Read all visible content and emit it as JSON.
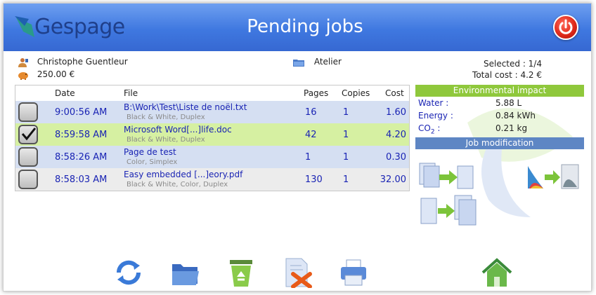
{
  "header": {
    "logo_text": "Gespage",
    "title": "Pending jobs",
    "power_icon": "power-icon"
  },
  "user": {
    "name": "Christophe Guentleur",
    "balance": "250.00 €",
    "printer": "Atelier"
  },
  "summary": {
    "selected": "Selected : 1/4",
    "total_cost": "Total cost : 4.2 €"
  },
  "jobs": {
    "columns": [
      "Date",
      "File",
      "Pages",
      "Copies",
      "Cost"
    ],
    "rows": [
      {
        "time": "9:00:56 AM",
        "file": "B:\\Work\\Test\\Liste de noël.txt",
        "desc": "Black & White, Duplex",
        "pages": "16",
        "copies": "1",
        "cost": "1.60",
        "checked": false,
        "bg": "#d5dff2"
      },
      {
        "time": "8:59:58 AM",
        "file": "Microsoft Word[...]life.doc",
        "desc": "Black & White, Duplex",
        "pages": "42",
        "copies": "1",
        "cost": "4.20",
        "checked": true,
        "bg": "#d6f0a2"
      },
      {
        "time": "8:58:26 AM",
        "file": "Page de test",
        "desc": "Color, Simplex",
        "pages": "1",
        "copies": "1",
        "cost": "0.30",
        "checked": false,
        "bg": "#d5dff2"
      },
      {
        "time": "8:58:03 AM",
        "file": "Easy embedded [...]eory.pdf",
        "desc": "Black & White, Color, Duplex",
        "pages": "130",
        "copies": "1",
        "cost": "32.00",
        "checked": false,
        "bg": "#ececec"
      }
    ]
  },
  "environment": {
    "title": "Environmental impact",
    "water_label": "Water :",
    "water_value": "5.88 L",
    "energy_label": "Energy :",
    "energy_value": "0.84 kWh",
    "co2_label_main": "CO",
    "co2_label_sub": "2",
    "co2_label_tail": " :",
    "co2_value": "0.21 kg"
  },
  "modification": {
    "title": "Job modification",
    "buttons": [
      "duplex-to-simplex-icon",
      "color-to-grayscale-icon",
      "simplex-to-duplex-icon"
    ]
  },
  "toolbar": {
    "buttons": [
      "refresh-icon",
      "folder-icon",
      "recycle-bin-icon",
      "delete-document-icon",
      "printer-icon",
      "home-icon"
    ]
  },
  "colors": {
    "header_blue": "#3f78e0",
    "link_blue": "#1a24b4",
    "env_green": "#8fc83c",
    "mod_blue": "#5e86c4",
    "power_red": "#e02a1a"
  }
}
